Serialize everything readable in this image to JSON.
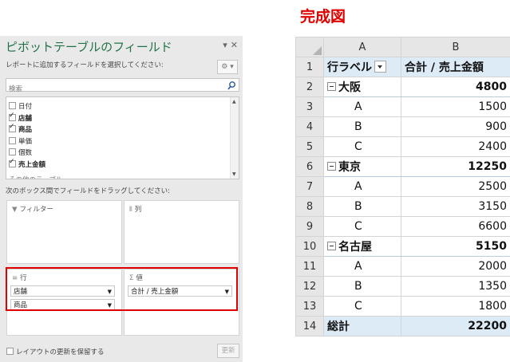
{
  "pane": {
    "title": "ピボットテーブルのフィールド",
    "subtitle": "レポートに追加するフィールドを選択してください:",
    "search_placeholder": "検索",
    "fields": [
      {
        "label": "日付",
        "checked": false
      },
      {
        "label": "店舗",
        "checked": true
      },
      {
        "label": "商品",
        "checked": true
      },
      {
        "label": "単価",
        "checked": false
      },
      {
        "label": "個数",
        "checked": false
      },
      {
        "label": "売上金額",
        "checked": true
      }
    ],
    "more_tables": "その他のテーブル...",
    "drag_hint": "次のボックス間でフィールドをドラッグしてください:",
    "areas": {
      "filter": "フィルター",
      "columns": "列",
      "rows": "行",
      "values": "値"
    },
    "row_fields": [
      "店舗",
      "商品"
    ],
    "value_fields": [
      "合計 / 売上金額"
    ],
    "defer_update": "レイアウトの更新を保留する",
    "update_button": "更新"
  },
  "result": {
    "title": "完成図",
    "columns": [
      "A",
      "B"
    ],
    "header": {
      "row_label": "行ラベル",
      "value_label": "合計 / 売上金額"
    },
    "rows": [
      {
        "n": "2",
        "label": "大阪",
        "value": "4800",
        "kind": "group"
      },
      {
        "n": "3",
        "label": "A",
        "value": "1500",
        "kind": "item"
      },
      {
        "n": "4",
        "label": "B",
        "value": "900",
        "kind": "item"
      },
      {
        "n": "5",
        "label": "C",
        "value": "2400",
        "kind": "item"
      },
      {
        "n": "6",
        "label": "東京",
        "value": "12250",
        "kind": "group"
      },
      {
        "n": "7",
        "label": "A",
        "value": "2500",
        "kind": "item"
      },
      {
        "n": "8",
        "label": "B",
        "value": "3150",
        "kind": "item"
      },
      {
        "n": "9",
        "label": "C",
        "value": "6600",
        "kind": "item"
      },
      {
        "n": "10",
        "label": "名古屋",
        "value": "5150",
        "kind": "group"
      },
      {
        "n": "11",
        "label": "A",
        "value": "2000",
        "kind": "item"
      },
      {
        "n": "12",
        "label": "B",
        "value": "1350",
        "kind": "item"
      },
      {
        "n": "13",
        "label": "C",
        "value": "1800",
        "kind": "item"
      }
    ],
    "total": {
      "n": "14",
      "label": "総計",
      "value": "22200"
    },
    "header_row_n": "1"
  }
}
